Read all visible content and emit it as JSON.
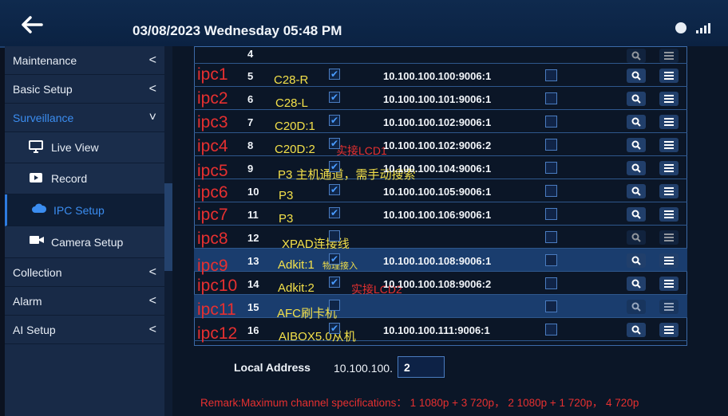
{
  "header": {
    "datetime": "03/08/2023 Wednesday 05:48 PM"
  },
  "sidebar": {
    "items": [
      {
        "label": "Maintenance",
        "chevron": "<"
      },
      {
        "label": "Basic Setup",
        "chevron": "<"
      },
      {
        "label": "Surveillance",
        "chevron": "˅"
      },
      {
        "label": "Live View"
      },
      {
        "label": "Record"
      },
      {
        "label": "IPC Setup"
      },
      {
        "label": "Camera Setup"
      },
      {
        "label": "Collection",
        "chevron": "<"
      },
      {
        "label": "Alarm",
        "chevron": "<"
      },
      {
        "label": "AI Setup",
        "chevron": "<"
      }
    ]
  },
  "table": {
    "rows": [
      {
        "num": "4"
      },
      {
        "num": "5",
        "ipc": "ipc1",
        "model": "C28-R",
        "address": "10.100.100.100:9006:1",
        "checked": true
      },
      {
        "num": "6",
        "ipc": "ipc2",
        "model": "C28-L",
        "address": "10.100.100.101:9006:1",
        "checked": true
      },
      {
        "num": "7",
        "ipc": "ipc3",
        "model": "C20D:1",
        "address": "10.100.100.102:9006:1",
        "checked": true
      },
      {
        "num": "8",
        "ipc": "ipc4",
        "model": "C20D:2",
        "note": "实接LCD1",
        "address": "10.100.100.102:9006:2",
        "checked": true
      },
      {
        "num": "9",
        "ipc": "ipc5",
        "model": "P3 主机通道，需手动搜索",
        "address": "10.100.100.104:9006:1",
        "checked": true
      },
      {
        "num": "10",
        "ipc": "ipc6",
        "model": "P3",
        "address": "10.100.100.105:9006:1",
        "checked": true
      },
      {
        "num": "11",
        "ipc": "ipc7",
        "model": "P3",
        "address": "10.100.100.106:9006:1",
        "checked": true
      },
      {
        "num": "12",
        "ipc": "ipc8",
        "model": "XPAD连接线",
        "address": "",
        "checked": false
      },
      {
        "num": "13",
        "ipc": "ipc9",
        "model": "Adkit:1",
        "note_small": "物理接入",
        "address": "10.100.100.108:9006:1",
        "checked": true
      },
      {
        "num": "14",
        "ipc": "ipc10",
        "model": "Adkit:2",
        "note": "实接LCD2",
        "address": "10.100.100.108:9006:2",
        "checked": true
      },
      {
        "num": "15",
        "ipc": "ipc11",
        "model": "AFC刷卡机",
        "address": "",
        "checked": false
      },
      {
        "num": "16",
        "ipc": "ipc12",
        "model": "AIBOX5.0从机",
        "address": "10.100.100.111:9006:1",
        "checked": true
      }
    ]
  },
  "local": {
    "label": "Local Address",
    "prefix": "10.100.100.",
    "value": "2"
  },
  "remark": "Remark:Maximum channel specifications： 1 1080p + 3 720p， 2 1080p + 1 720p， 4 720p",
  "colors": {
    "accent": "#3b8df0",
    "annotation_red": "#e63030",
    "annotation_yellow": "#f3e04a"
  }
}
